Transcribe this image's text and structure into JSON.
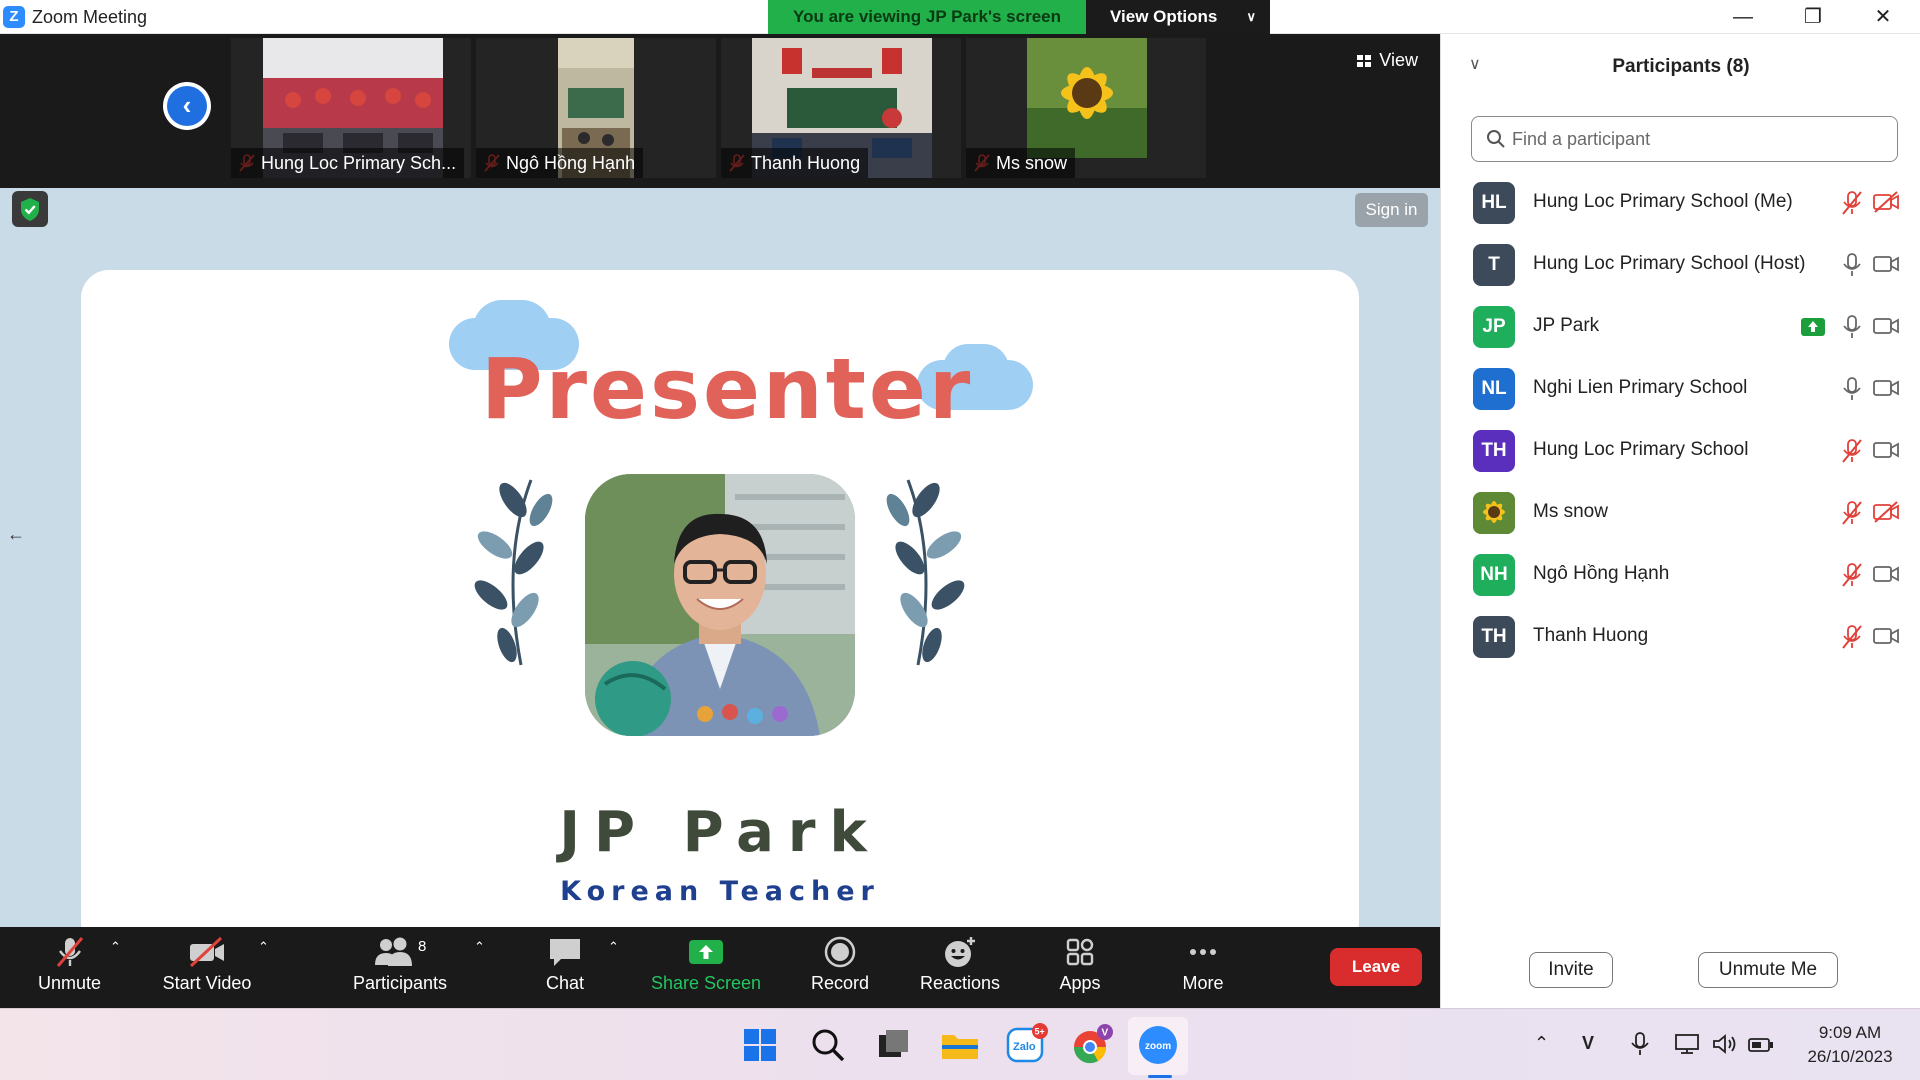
{
  "window": {
    "app_icon": "Z",
    "title": "Zoom Meeting",
    "viewing_banner": "You are viewing JP Park's screen",
    "view_options": "View Options",
    "controls": [
      "minimize",
      "maximize",
      "close"
    ]
  },
  "video_strip": {
    "tiles": [
      {
        "name": "Hung Loc Primary Sch...",
        "muted": true
      },
      {
        "name": "Ngô Hồng Hạnh",
        "muted": true
      },
      {
        "name": "Thanh Huong",
        "muted": true
      },
      {
        "name": "Ms snow",
        "muted": true
      }
    ],
    "view_label": "View"
  },
  "sign_in": "Sign in",
  "slide": {
    "heading": "Presenter",
    "name": "JP Park",
    "role": "Korean Teacher"
  },
  "toolbar": {
    "unmute": "Unmute",
    "start_video": "Start Video",
    "participants": "Participants",
    "participants_count": "8",
    "chat": "Chat",
    "share_screen": "Share Screen",
    "record": "Record",
    "reactions": "Reactions",
    "apps": "Apps",
    "more": "More",
    "leave": "Leave"
  },
  "panel": {
    "title": "Participants (8)",
    "search_placeholder": "Find a participant",
    "participants": [
      {
        "initials": "HL",
        "name": "Hung Loc Primary School (Me)",
        "color": "#3d4a5a",
        "mic": "muted",
        "video": "off",
        "sharing": false
      },
      {
        "initials": "T",
        "name": "Hung Loc Primary School (Host)",
        "color": "#3d4a5a",
        "mic": "on",
        "video": "on",
        "sharing": false
      },
      {
        "initials": "JP",
        "name": "JP Park",
        "color": "#1fae5b",
        "mic": "on",
        "video": "on",
        "sharing": true
      },
      {
        "initials": "NL",
        "name": "Nghi Lien Primary School",
        "color": "#1e6fd0",
        "mic": "on",
        "video": "on",
        "sharing": false
      },
      {
        "initials": "TH",
        "name": "Hung Loc Primary School",
        "color": "#5b2fbe",
        "mic": "muted",
        "video": "on",
        "sharing": false
      },
      {
        "initials": "",
        "name": "Ms snow",
        "color": "#4f7f3a",
        "mic": "muted",
        "video": "off",
        "sharing": false
      },
      {
        "initials": "NH",
        "name": "Ngô Hồng Hạnh",
        "color": "#1fae5b",
        "mic": "muted",
        "video": "on",
        "sharing": false
      },
      {
        "initials": "TH",
        "name": "Thanh Huong",
        "color": "#3d4a5a",
        "mic": "muted",
        "video": "on",
        "sharing": false
      }
    ],
    "invite": "Invite",
    "unmute_me": "Unmute Me"
  },
  "taskbar": {
    "apps": [
      "windows-start",
      "search",
      "task-view",
      "file-explorer",
      "zalo",
      "chrome",
      "zoom"
    ],
    "zalo_badge": "5+",
    "chrome_badge": "V",
    "clock_time": "9:09 AM",
    "clock_date": "26/10/2023"
  }
}
